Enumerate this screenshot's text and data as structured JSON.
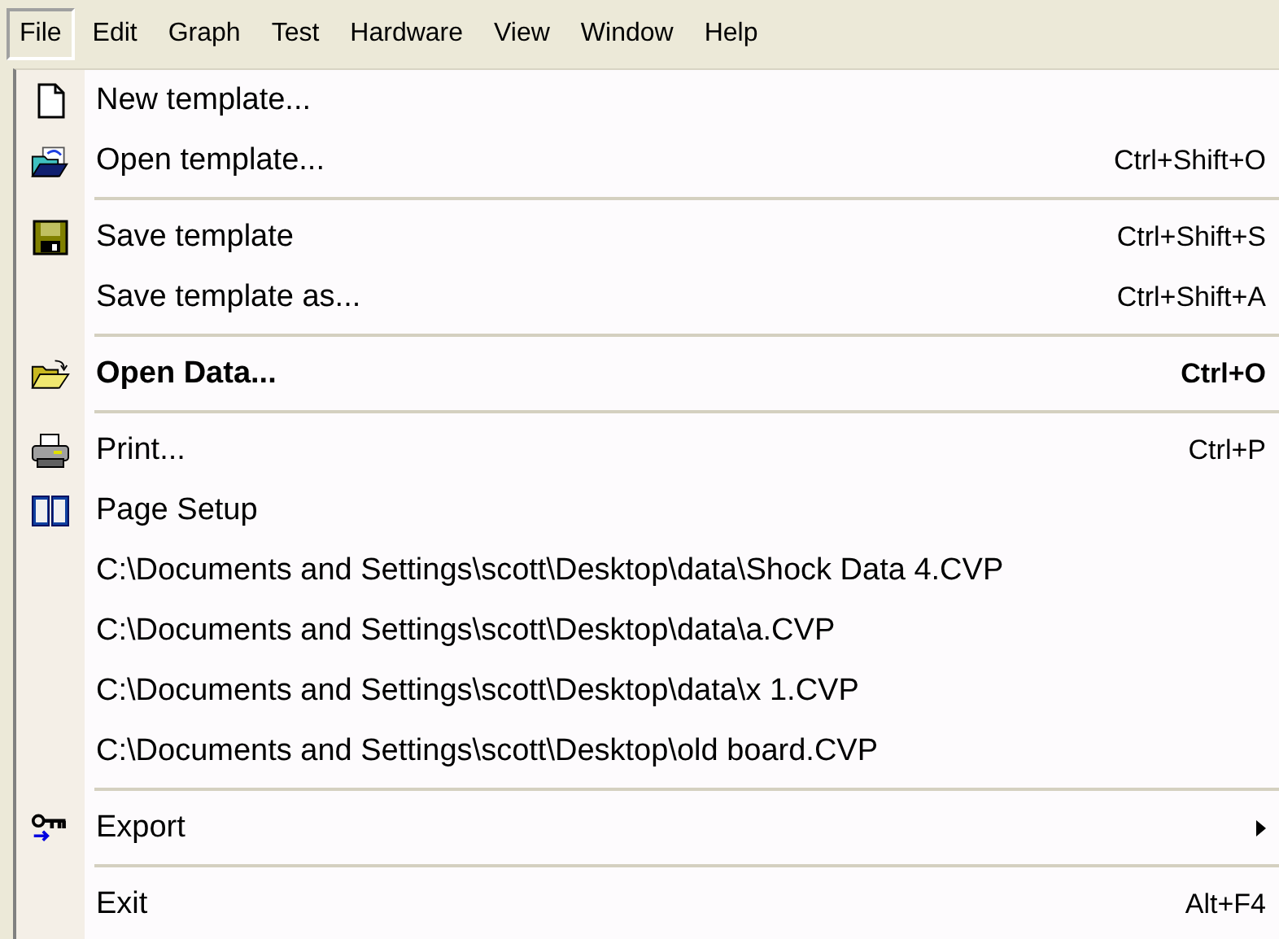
{
  "menubar": [
    {
      "label": "File",
      "selected": true
    },
    {
      "label": "Edit",
      "selected": false
    },
    {
      "label": "Graph",
      "selected": false
    },
    {
      "label": "Test",
      "selected": false
    },
    {
      "label": "Hardware",
      "selected": false
    },
    {
      "label": "View",
      "selected": false
    },
    {
      "label": "Window",
      "selected": false
    },
    {
      "label": "Help",
      "selected": false
    }
  ],
  "menu": [
    {
      "kind": "item",
      "label": "New template..."
    },
    {
      "kind": "item",
      "label": "Open template...",
      "shortcut": "Ctrl+Shift+O"
    },
    {
      "kind": "separator"
    },
    {
      "kind": "item",
      "label": "Save template",
      "shortcut": "Ctrl+Shift+S"
    },
    {
      "kind": "item",
      "label": "Save template as...",
      "shortcut": "Ctrl+Shift+A"
    },
    {
      "kind": "separator"
    },
    {
      "kind": "item",
      "label": "Open Data...",
      "shortcut": "Ctrl+O",
      "bold": true
    },
    {
      "kind": "separator"
    },
    {
      "kind": "item",
      "label": "Print...",
      "shortcut": "Ctrl+P"
    },
    {
      "kind": "item",
      "label": "Page Setup"
    },
    {
      "kind": "item",
      "label": "C:\\Documents and Settings\\scott\\Desktop\\data\\Shock Data 4.CVP"
    },
    {
      "kind": "item",
      "label": "C:\\Documents and Settings\\scott\\Desktop\\data\\a.CVP"
    },
    {
      "kind": "item",
      "label": "C:\\Documents and Settings\\scott\\Desktop\\data\\x 1.CVP"
    },
    {
      "kind": "item",
      "label": "C:\\Documents and Settings\\scott\\Desktop\\old board.CVP"
    },
    {
      "kind": "separator"
    },
    {
      "kind": "item",
      "label": "Export",
      "submenu": true
    },
    {
      "kind": "separator"
    },
    {
      "kind": "item",
      "label": "Exit",
      "shortcut": "Alt+F4"
    }
  ]
}
